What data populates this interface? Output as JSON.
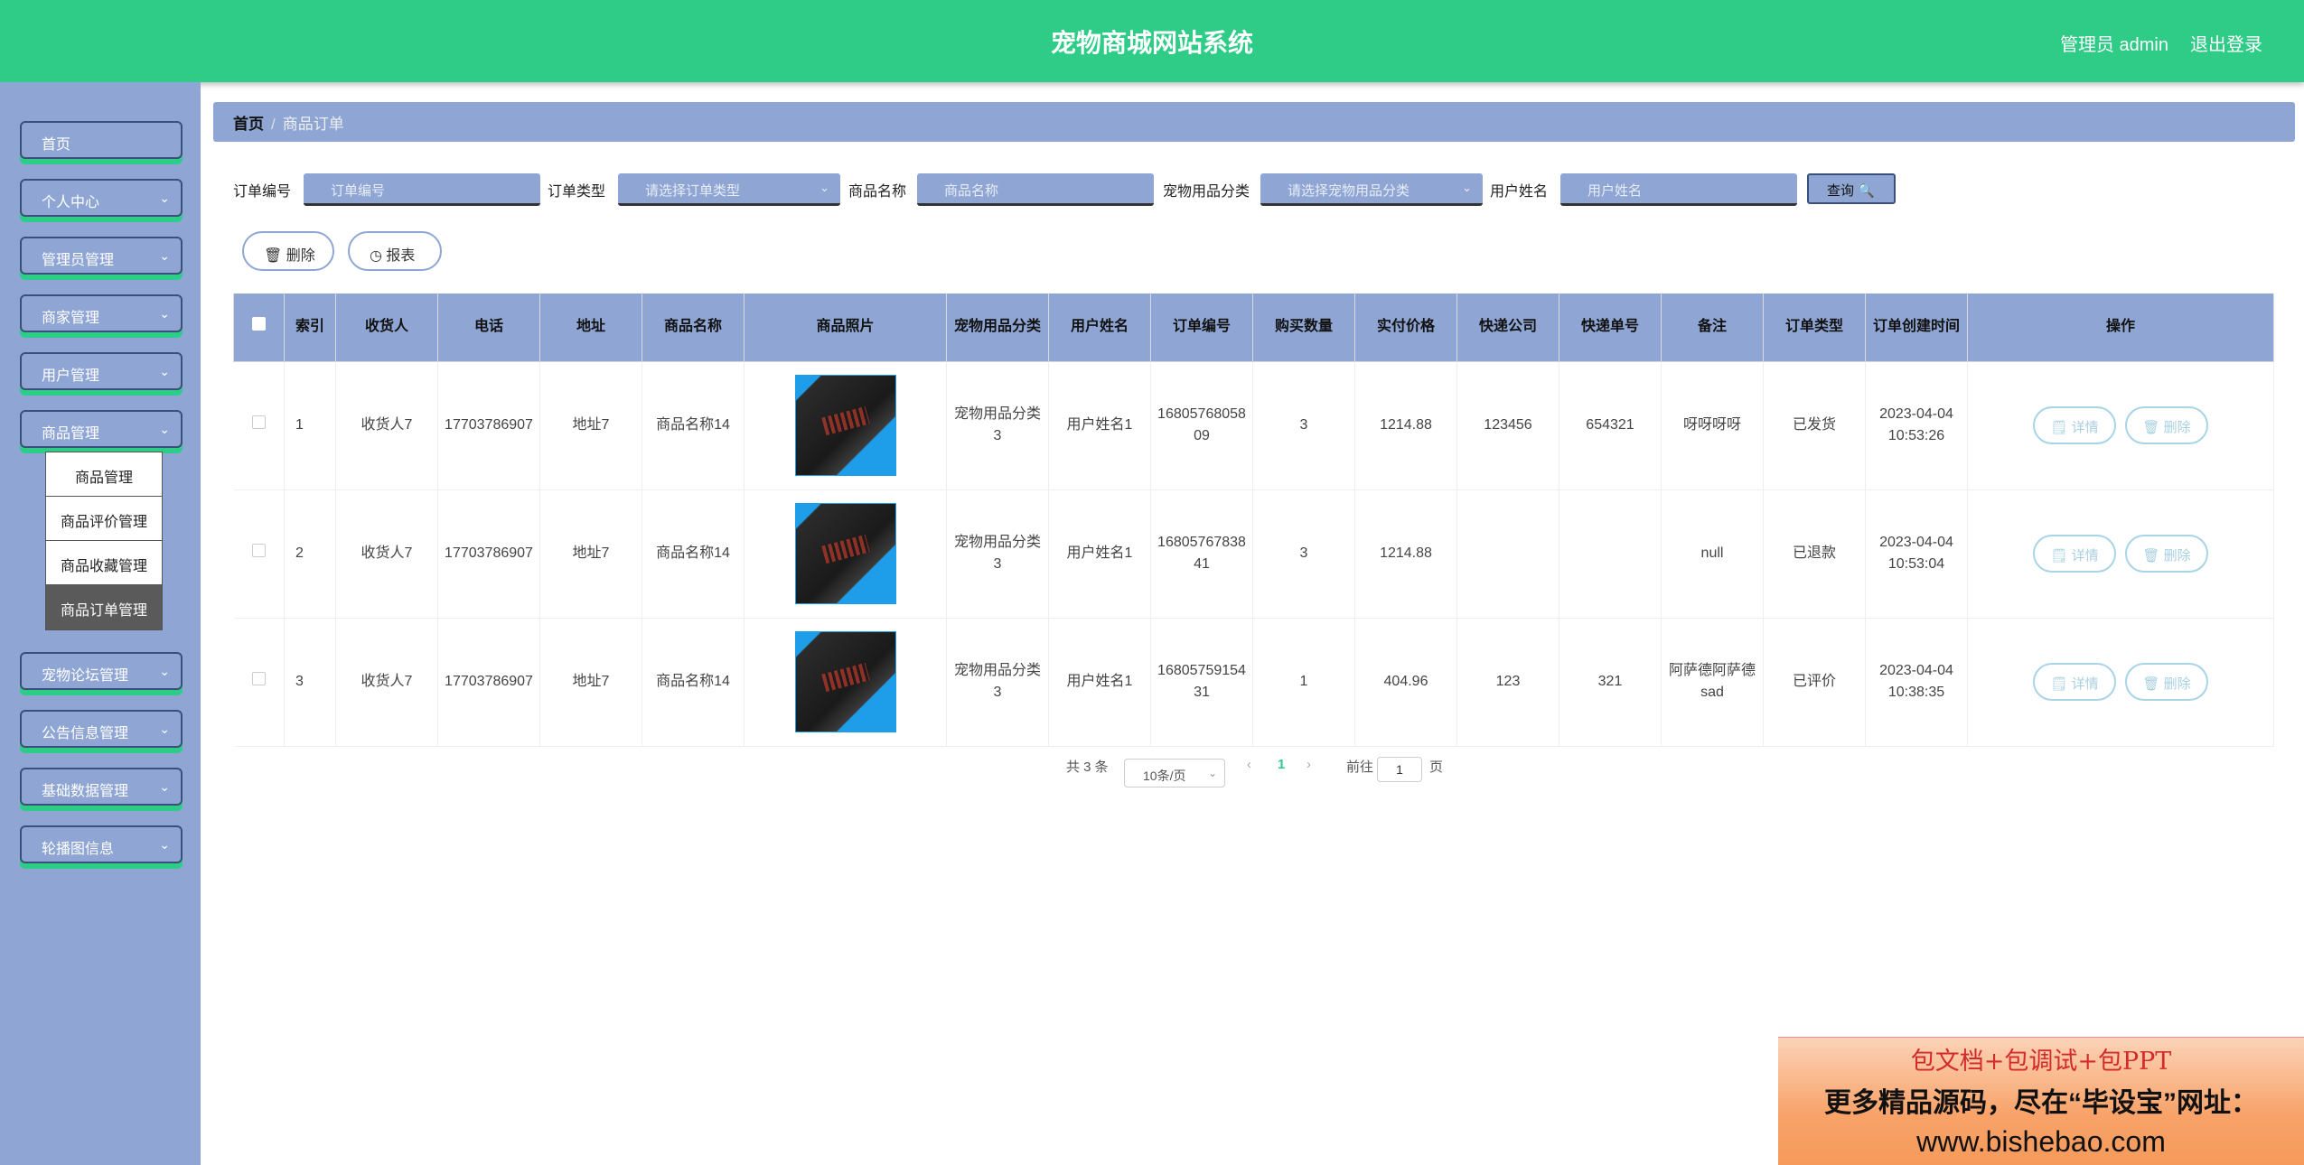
{
  "header": {
    "title": "宠物商城网站系统",
    "user": "管理员 admin",
    "logout": "退出登录"
  },
  "sidebar": {
    "items": [
      {
        "label": "首页",
        "chev": ""
      },
      {
        "label": "个人中心",
        "chev": "⌄"
      },
      {
        "label": "管理员管理",
        "chev": "⌄"
      },
      {
        "label": "商家管理",
        "chev": "⌄"
      },
      {
        "label": "用户管理",
        "chev": "⌄"
      },
      {
        "label": "商品管理",
        "chev": "⌄"
      },
      {
        "label": "宠物论坛管理",
        "chev": "⌄"
      },
      {
        "label": "公告信息管理",
        "chev": "⌄"
      },
      {
        "label": "基础数据管理",
        "chev": "⌄"
      },
      {
        "label": "轮播图信息",
        "chev": "⌄"
      }
    ],
    "submenu": [
      "商品管理",
      "商品评价管理",
      "商品收藏管理",
      "商品订单管理"
    ]
  },
  "breadcrumb": {
    "home": "首页",
    "sep": "/",
    "current": "商品订单"
  },
  "filters": {
    "order_no_label": "订单编号",
    "order_no_placeholder": "订单编号",
    "order_type_label": "订单类型",
    "order_type_placeholder": "请选择订单类型",
    "product_name_label": "商品名称",
    "product_name_placeholder": "商品名称",
    "category_label": "宠物用品分类",
    "category_placeholder": "请选择宠物用品分类",
    "user_name_label": "用户姓名",
    "user_name_placeholder": "用户姓名",
    "query": "查询 🔍"
  },
  "actions": {
    "delete": "🗑 删除",
    "report": "◷ 报表"
  },
  "table": {
    "headers": [
      "",
      "索引",
      "收货人",
      "电话",
      "地址",
      "商品名称",
      "商品照片",
      "宠物用品分类",
      "用户姓名",
      "订单编号",
      "购买数量",
      "实付价格",
      "快递公司",
      "快递单号",
      "备注",
      "订单类型",
      "订单创建时间",
      "操作"
    ],
    "rows": [
      {
        "index": "1",
        "receiver": "收货人7",
        "phone": "17703786907",
        "address": "地址7",
        "product": "商品名称14",
        "category": "宠物用品分类3",
        "user": "用户姓名1",
        "order_no": "1680576805809",
        "qty": "3",
        "price": "1214.88",
        "courier": "123456",
        "tracking": "654321",
        "note": "呀呀呀呀",
        "type": "已发货",
        "created": "2023-04-04 10:53:26"
      },
      {
        "index": "2",
        "receiver": "收货人7",
        "phone": "17703786907",
        "address": "地址7",
        "product": "商品名称14",
        "category": "宠物用品分类3",
        "user": "用户姓名1",
        "order_no": "1680576783841",
        "qty": "3",
        "price": "1214.88",
        "courier": "",
        "tracking": "",
        "note": "null",
        "type": "已退款",
        "created": "2023-04-04 10:53:04"
      },
      {
        "index": "3",
        "receiver": "收货人7",
        "phone": "17703786907",
        "address": "地址7",
        "product": "商品名称14",
        "category": "宠物用品分类3",
        "user": "用户姓名1",
        "order_no": "1680575915431",
        "qty": "1",
        "price": "404.96",
        "courier": "123",
        "tracking": "321",
        "note": "阿萨德阿萨德sad",
        "type": "已评价",
        "created": "2023-04-04 10:38:35"
      }
    ],
    "detail_btn": "🗒 详情",
    "delete_btn": "🗑 删除"
  },
  "pager": {
    "total": "共 3 条",
    "size": "10条/页",
    "prev": "‹",
    "page": "1",
    "next": "›",
    "goto": "前往",
    "goto_value": "1",
    "page_unit": "页"
  },
  "promo": {
    "line1": "包文档+包调试+包PPT",
    "line2": "更多精品源码，尽在“毕设宝”网址：",
    "line3": "www.bishebao.com"
  },
  "colors": {
    "header": "#2ecc87",
    "sidebar": "#8fa6d4",
    "accent": "#2ecc87"
  }
}
